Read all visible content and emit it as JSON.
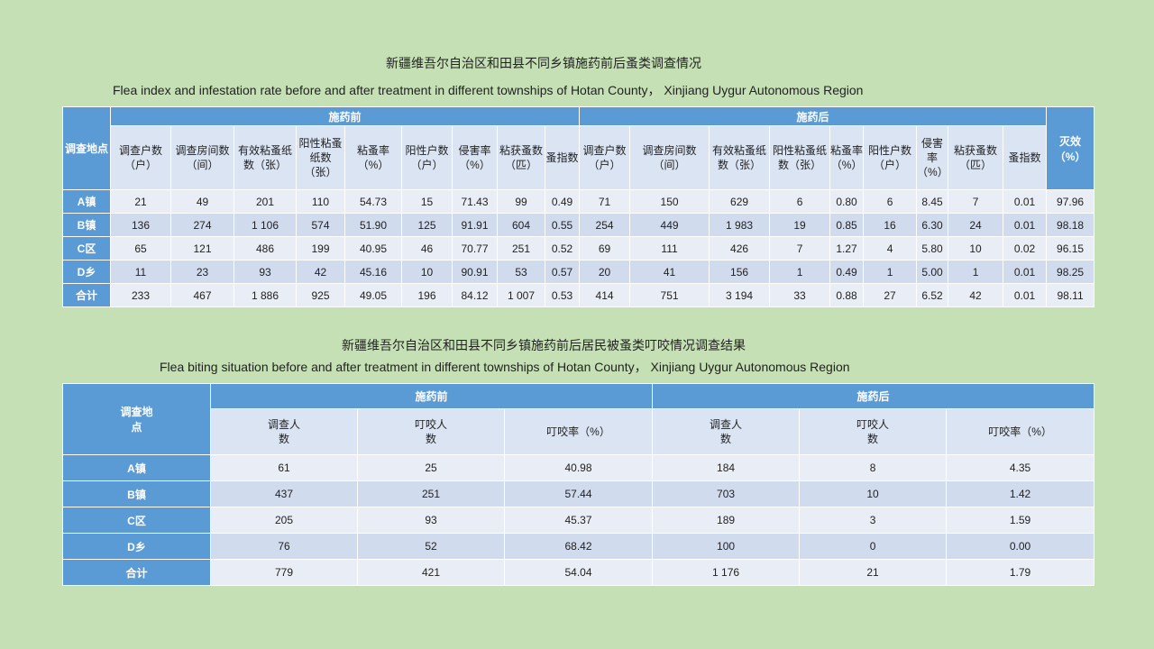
{
  "table1": {
    "title_cn": "新疆维吾尔自治区和田县不同乡镇施药前后蚤类调查情况",
    "title_en": "Flea index and infestation rate before and after treatment  in different townships of Hotan County，  Xinjiang Uygur Autonomous Region",
    "location_header": "调查地点",
    "group_before": "施药前",
    "group_after": "施药后",
    "effect_header": "灭效（%）",
    "cols_before": [
      "调查户数（户）",
      "调查房间数（间）",
      "有效粘蚤纸数（张）",
      "阳性粘蚤纸数（张）",
      "粘蚤率（%）",
      "阳性户数（户）",
      "侵害率（%）",
      "粘获蚤数（匹）",
      "蚤指数"
    ],
    "cols_after": [
      "调查户数（户）",
      "调查房间数（间）",
      "有效粘蚤纸数（张）",
      "阳性粘蚤纸数（张）",
      "粘蚤率（%）",
      "阳性户数（户）",
      "侵害率（%）",
      "粘获蚤数（匹）",
      "蚤指数"
    ],
    "rows": [
      {
        "name": "A镇",
        "values": [
          "21",
          "49",
          "201",
          "110",
          "54.73",
          "15",
          "71.43",
          "99",
          "0.49",
          "71",
          "150",
          "629",
          "6",
          "0.80",
          "6",
          "8.45",
          "7",
          "0.01",
          "97.96"
        ]
      },
      {
        "name": "B镇",
        "values": [
          "136",
          "274",
          "1 106",
          "574",
          "51.90",
          "125",
          "91.91",
          "604",
          "0.55",
          "254",
          "449",
          "1 983",
          "19",
          "0.85",
          "16",
          "6.30",
          "24",
          "0.01",
          "98.18"
        ]
      },
      {
        "name": "C区",
        "values": [
          "65",
          "121",
          "486",
          "199",
          "40.95",
          "46",
          "70.77",
          "251",
          "0.52",
          "69",
          "111",
          "426",
          "7",
          "1.27",
          "4",
          "5.80",
          "10",
          "0.02",
          "96.15"
        ]
      },
      {
        "name": "D乡",
        "values": [
          "11",
          "23",
          "93",
          "42",
          "45.16",
          "10",
          "90.91",
          "53",
          "0.57",
          "20",
          "41",
          "156",
          "1",
          "0.49",
          "1",
          "5.00",
          "1",
          "0.01",
          "98.25"
        ]
      },
      {
        "name": "合计",
        "values": [
          "233",
          "467",
          "1 886",
          "925",
          "49.05",
          "196",
          "84.12",
          "1 007",
          "0.53",
          "414",
          "751",
          "3 194",
          "33",
          "0.88",
          "27",
          "6.52",
          "42",
          "0.01",
          "98.11"
        ]
      }
    ]
  },
  "table2": {
    "title_cn": "新疆维吾尔自治区和田县不同乡镇施药前后居民被蚤类叮咬情况调查结果",
    "title_en": "Flea biting situation before and after treatment  in different townships of Hotan County，  Xinjiang Uygur Autonomous Region",
    "location_header": "调查地点",
    "group_before": "施药前",
    "group_after": "施药后",
    "cols": [
      "调查人数",
      "叮咬人数",
      "叮咬率（%）",
      "调查人数",
      "叮咬人数",
      "叮咬率（%）"
    ],
    "rows": [
      {
        "name": "A镇",
        "values": [
          "61",
          "25",
          "40.98",
          "184",
          "8",
          "4.35"
        ]
      },
      {
        "name": "B镇",
        "values": [
          "437",
          "251",
          "57.44",
          "703",
          "10",
          "1.42"
        ]
      },
      {
        "name": "C区",
        "values": [
          "205",
          "93",
          "45.37",
          "189",
          "3",
          "1.59"
        ]
      },
      {
        "name": "D乡",
        "values": [
          "76",
          "52",
          "68.42",
          "100",
          "0",
          "0.00"
        ]
      },
      {
        "name": "合计",
        "values": [
          "779",
          "421",
          "54.04",
          "1 176",
          "21",
          "1.79"
        ]
      }
    ]
  }
}
